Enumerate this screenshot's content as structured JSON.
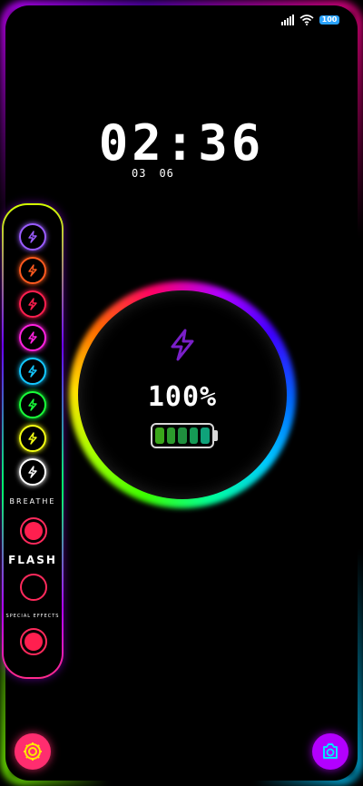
{
  "status_bar": {
    "battery_level": "100",
    "signal_icon": "signal-icon",
    "wifi_icon": "wifi-icon"
  },
  "clock": {
    "time": "02:36",
    "month": "03",
    "day": "06"
  },
  "side_panel": {
    "color_options": [
      {
        "name": "rainbow",
        "color": "#9a5cff"
      },
      {
        "name": "orange",
        "color": "#ff5a1f"
      },
      {
        "name": "red",
        "color": "#ff1f4f"
      },
      {
        "name": "magenta",
        "color": "#ff22e0"
      },
      {
        "name": "cyan",
        "color": "#14c8ff"
      },
      {
        "name": "green",
        "color": "#19ff3a"
      },
      {
        "name": "yellow",
        "color": "#f4ff14"
      },
      {
        "name": "white",
        "color": "#ffffff"
      }
    ],
    "breathe_label": "BREATHE",
    "breathe_on": true,
    "flash_label": "FLASH",
    "flash_on": false,
    "effects_label": "SPECIAL  EFFECTS",
    "effects_on": true
  },
  "charging": {
    "percent": "100%",
    "bolt_icon": "bolt-icon",
    "level": 1.0,
    "cell_colors": [
      "#3aa61a",
      "#2c9a2d",
      "#1f8f3e",
      "#159a56",
      "#0fa27a"
    ]
  },
  "bottom": {
    "settings_icon": "gear-icon",
    "camera_icon": "camera-icon"
  },
  "colors": {
    "accent_pink": "#ff2d6f",
    "accent_purple": "#b300ff"
  }
}
